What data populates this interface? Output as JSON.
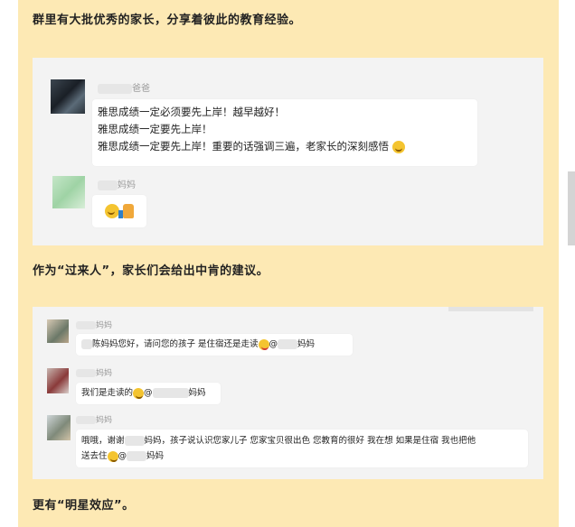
{
  "paragraphs": {
    "intro": "群里有大批优秀的家长，分享着彼此的教育经验。",
    "middle": "作为“过来人”，家长们会给出中肯的建议。",
    "outro": "更有“明星效应”。"
  },
  "chat1": {
    "sender1": "爸爸",
    "msg1_lines": [
      "雅思成绩一定必须要先上岸！越早越好！",
      "雅思成绩一定要先上岸！",
      "雅思成绩一定要先上岸！重要的话强调三遍，老家长的深刻感悟"
    ],
    "sender2": "妈妈"
  },
  "chat2": {
    "sender1": "妈妈",
    "msg1_a": "陈妈妈您好，请问您的孩子 是住宿还是走读",
    "msg1_at": "@",
    "msg1_b": "妈妈",
    "sender2": "妈妈",
    "msg2_a": "我们是走读的",
    "msg2_at": "@",
    "msg2_b": "妈妈",
    "sender3": "妈妈",
    "msg3_l1_a": "哦哦，谢谢",
    "msg3_l1_b": "妈妈，孩子说认识您家儿子 您家宝贝很出色 您教育的很好 我在想 如果是住宿 我也把他",
    "msg3_l2_a": "送去住",
    "msg3_l2_at": "@",
    "msg3_l2_b": "妈妈"
  },
  "colors": {
    "background": "#fde9b4",
    "screenshot": "#f3f3f3",
    "bubble": "#ffffff"
  },
  "icons": [
    "smile-emoji-icon",
    "thumbs-up-icon",
    "wink-emoji-icon",
    "grin-emoji-icon"
  ]
}
